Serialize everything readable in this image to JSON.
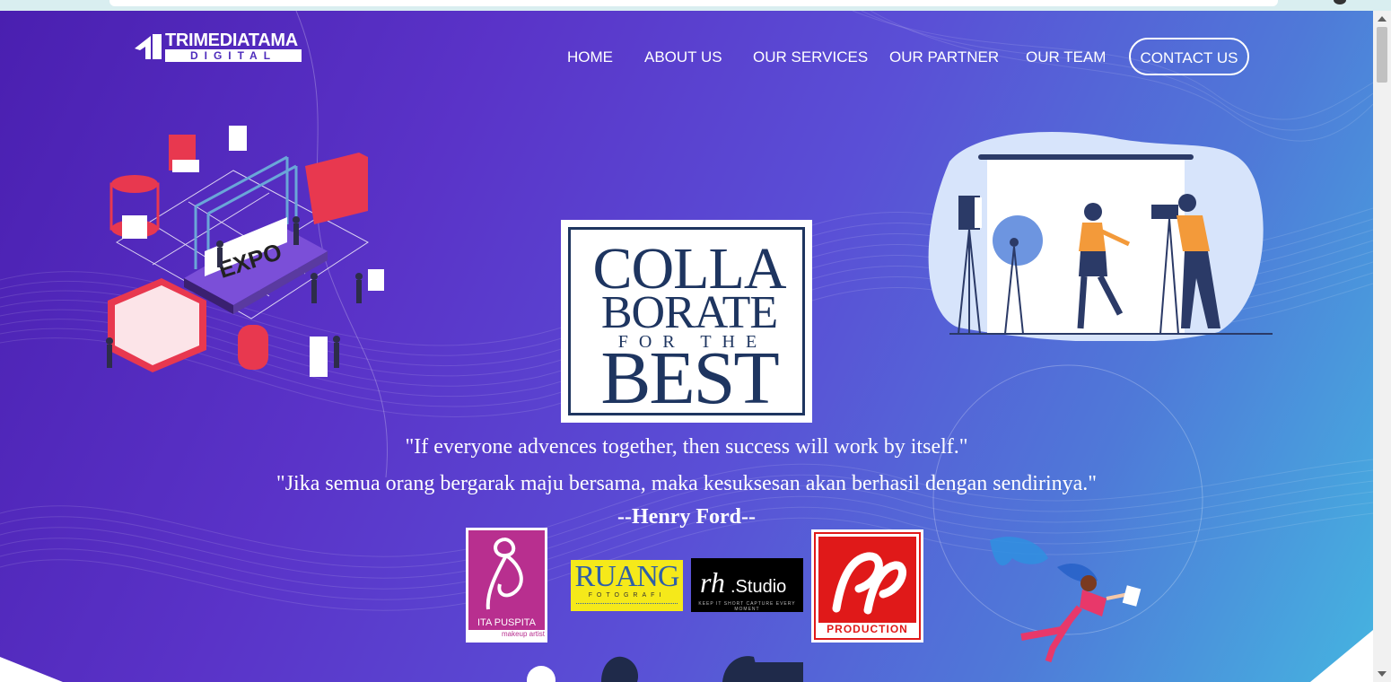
{
  "brand": {
    "line1": "TRIMEDIATAMA",
    "line2": "DIGITAL"
  },
  "nav": {
    "items": [
      {
        "label": "HOME"
      },
      {
        "label": "ABOUT US"
      },
      {
        "label": "OUR SERVICES"
      },
      {
        "label": "OUR PARTNER"
      },
      {
        "label": "OUR TEAM"
      }
    ],
    "contact_label": "CONTACT US"
  },
  "hero": {
    "card": {
      "line1": "COLLA",
      "line2": "BORATE",
      "line3": "FOR THE",
      "line4": "BEST"
    },
    "quote_en": "\"If everyone advences together, then success will work by itself.\"",
    "quote_id": "\"Jika semua orang bergarak maju bersama, maka kesuksesan akan berhasil dengan sendirinya.\"",
    "author": "--Henry Ford--",
    "expo_sign": "EXPO"
  },
  "partners": {
    "ita_name": "ITA PUSPITA",
    "ita_sub": "makeup artist",
    "ruang_name": "RUANG",
    "ruang_sub": "FOTOGRAFI",
    "rh_name": "rh",
    "rh_suffix": ".Studio",
    "rh_tag": "KEEP IT SHORT CAPTURE EVERY MOMENT",
    "pp_name": "PRODUCTION"
  },
  "colors": {
    "bg_start": "#4a1fb0",
    "bg_end": "#45b4e0",
    "card_text": "#1e3560",
    "ita": "#b82f8f",
    "ruang": "#f5e91a",
    "pp": "#e01919"
  }
}
